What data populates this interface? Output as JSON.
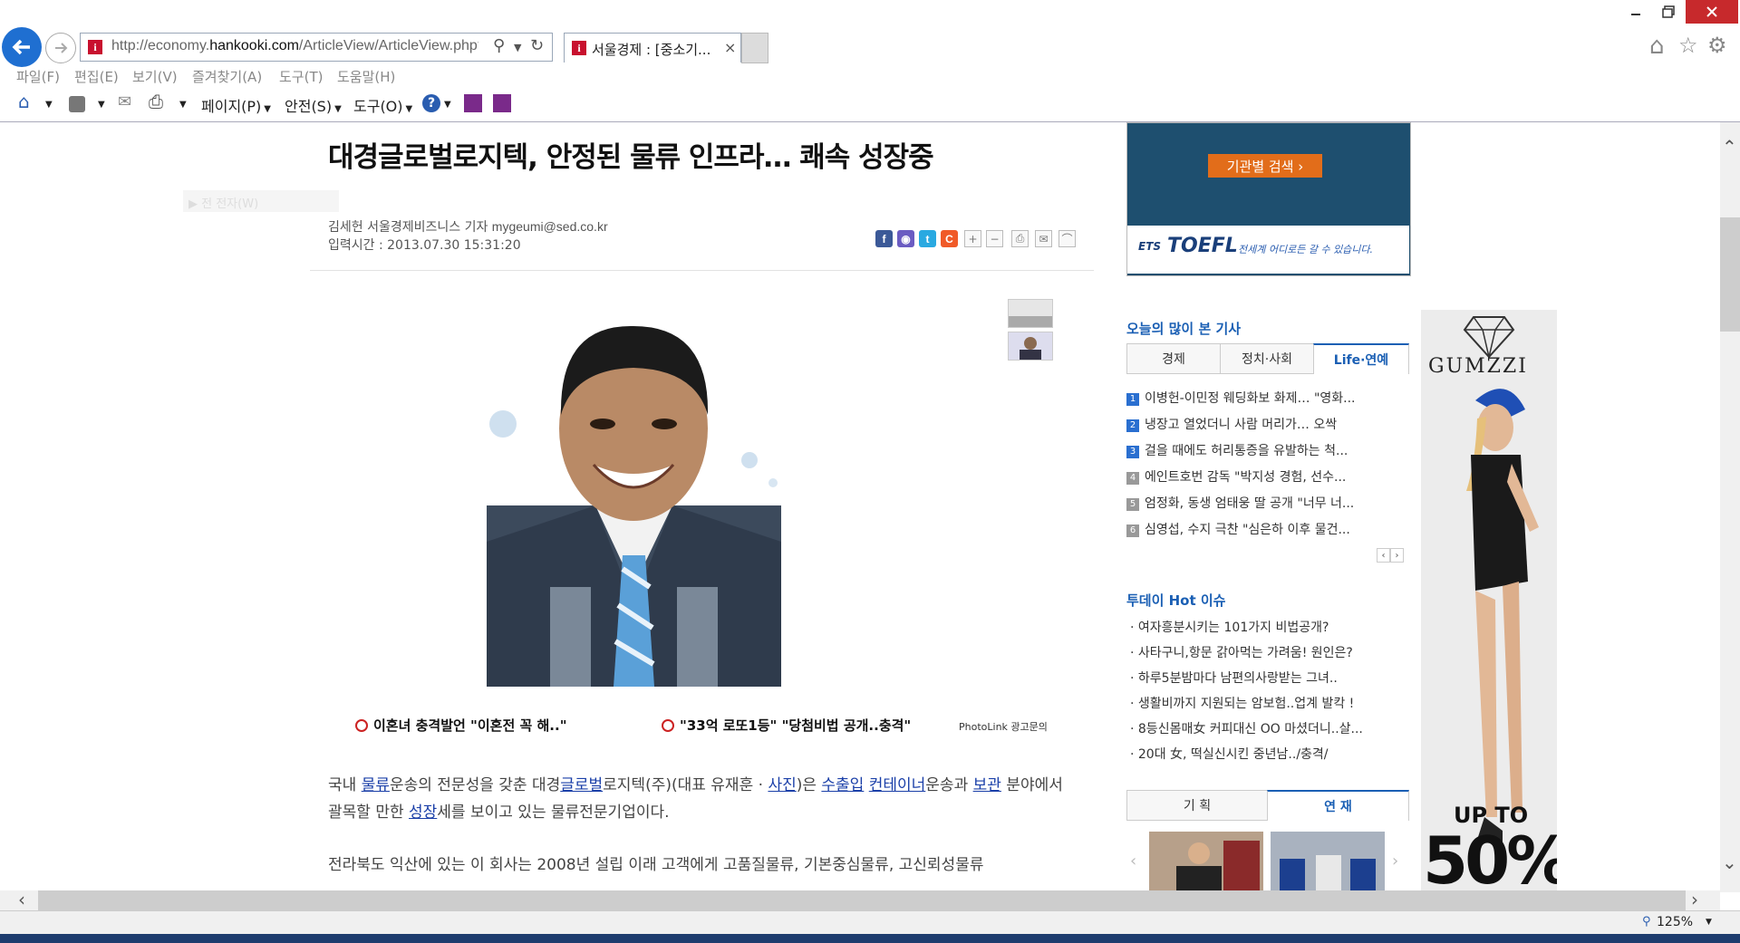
{
  "browser": {
    "address_url": "http://economy.hankooki.com/ArticleView/ArticleView.php?u",
    "url_prefix": "http://economy.",
    "url_domain": "hankooki.com",
    "url_path": "/ArticleView/ArticleView.php?u",
    "tab_title": "서울경제 : [중소기...",
    "tab_close": "×",
    "favicon_letter": "i",
    "menu": [
      "파일(F)",
      "편집(E)",
      "보기(V)",
      "즐겨찾기(A)",
      "도구(T)",
      "도움말(H)"
    ],
    "cmd_page": "페이지(P)",
    "cmd_safety": "안전(S)",
    "cmd_tools": "도구(O)",
    "zoom": "125%"
  },
  "article": {
    "title": "대경글로벌로지텍, 안정된 물류 인프라… 쾌속 성장중",
    "page_button": "▶ 전 전자(W)",
    "byline": "김세헌 서울경제비즈니스 기자",
    "email": "mygeumi@sed.co.kr",
    "timestamp": "입력시간 : 2013.07.30 15:31:20",
    "ad_link_1": "이혼녀 충격발언 \"이혼전 꼭 해..\"",
    "ad_link_2": "\"33억 로또1등\" \"당첨비법 공개..충격\"",
    "photolink": "PhotoLink 광고문의",
    "para1": {
      "t1": "국내 ",
      "l1": "물류",
      "t2": "운송의 전문성을 갖춘 대경",
      "l2": "글로벌",
      "t3": "로지텍(주)(대표 유재훈 · ",
      "l3": "사진",
      "t4": ")은 ",
      "l4": "수출입",
      "t5": " ",
      "l5": "컨테이너",
      "t6": "운송과 ",
      "l6": "보관",
      "t7": " 분야에서 괄목할 만한 ",
      "l7": "성장",
      "t8": "세를 보이고 있는 물류전문기업이다."
    },
    "para2": "전라북도 익산에 있는 이 회사는 2008년 설립 이래 고객에게 고품질물류, 기본중심물류, 고신뢰성물류"
  },
  "sidebar": {
    "inst_search": "기관별 검색 ›",
    "toefl_logo": "TOEFL",
    "toefl_ets": "ETS",
    "toefl_tagline": "전세계 어디로든 갈 수 있습니다.",
    "popular_title": "오늘의 많이 본 기사",
    "tabs": [
      "경제",
      "정치·사회",
      "Life·연예"
    ],
    "ranks": [
      {
        "n": "1",
        "text": "이병헌-이민정 웨딩화보 화제… \"영화..."
      },
      {
        "n": "2",
        "text": "냉장고 열었더니 사람 머리가… 오싹"
      },
      {
        "n": "3",
        "text": "걸을 때에도 허리통증을 유발하는 척..."
      },
      {
        "n": "4",
        "text": "에인트호번 감독 \"박지성 경험, 선수..."
      },
      {
        "n": "5",
        "text": "엄정화, 동생 엄태웅 딸 공개 \"너무 너..."
      },
      {
        "n": "6",
        "text": "심영섭, 수지 극찬 \"심은하 이후 물건..."
      }
    ],
    "hot_title": "투데이 Hot 이슈",
    "hot": [
      "· 여자흥분시키는 101가지 비법공개?",
      "· 사타구니,항문 갉아먹는 가려움! 원인은?",
      "· 하루5분밤마다 남편의사랑받는 그녀..",
      "· 생활비까지 지원되는 암보험..업계 발칵 !",
      "· 8등신몸매女 커피대신 OO 마셨더니..살...",
      "· 20대 女, 떡실신시킨 중년남../충격/"
    ],
    "tabs2": [
      "기 획",
      "연 재"
    ],
    "gumzzi_brand": "GUMZZI",
    "gumzzi_upto": "UP TO",
    "gumzzi_pct": "50%"
  },
  "colors": {
    "accent": "#1a5fb4",
    "back_button": "#1f6fd1",
    "close": "#c7292c",
    "inst_ad": "#1e4f6f",
    "inst_btn": "#e26d1a"
  }
}
